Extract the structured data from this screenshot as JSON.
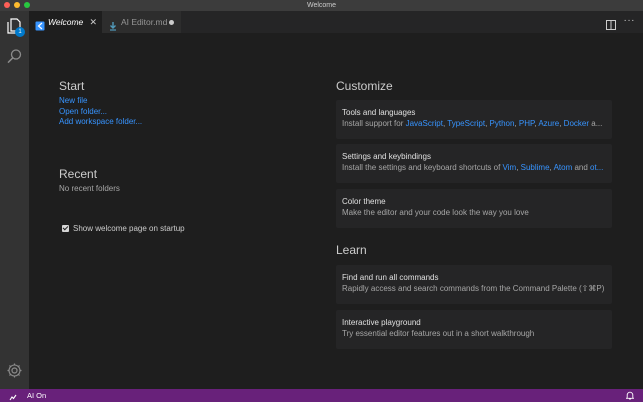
{
  "window": {
    "title": "Welcome"
  },
  "activity": {
    "explorer_badge": "1"
  },
  "tabs": [
    {
      "label": "Welcome",
      "close": "✕"
    },
    {
      "label": "AI Editor.md"
    }
  ],
  "tab_actions": {
    "more": "···"
  },
  "start": {
    "heading": "Start",
    "links": [
      "New file",
      "Open folder...",
      "Add workspace folder..."
    ]
  },
  "recent": {
    "heading": "Recent",
    "empty": "No recent folders"
  },
  "startup": {
    "label": "Show welcome page on startup",
    "checked": true
  },
  "customize": {
    "heading": "Customize",
    "cards": [
      {
        "title": "Tools and languages",
        "desc_prefix": "Install support for ",
        "items": [
          "JavaScript",
          "TypeScript",
          "Python",
          "PHP",
          "Azure",
          "Docker"
        ],
        "sep": ", ",
        "tail": " a..."
      },
      {
        "title": "Settings and keybindings",
        "desc_prefix": "Install the settings and keyboard shortcuts of ",
        "items": [
          "Vim",
          "Sublime",
          "Atom"
        ],
        "sep": ", ",
        "and": " and ",
        "tail_link": "ot..."
      },
      {
        "title": "Color theme",
        "desc": "Make the editor and your code look the way you love"
      }
    ]
  },
  "learn": {
    "heading": "Learn",
    "cards": [
      {
        "title": "Find and run all commands",
        "desc": "Rapidly access and search commands from the Command Palette (⇧⌘P)"
      },
      {
        "title": "Interactive playground",
        "desc": "Try essential editor features out in a short walkthrough"
      }
    ]
  },
  "status": {
    "text": "AI On"
  },
  "colors": {
    "statusbar": "#68217a",
    "link": "#3794ff",
    "accent": "#007acc"
  }
}
